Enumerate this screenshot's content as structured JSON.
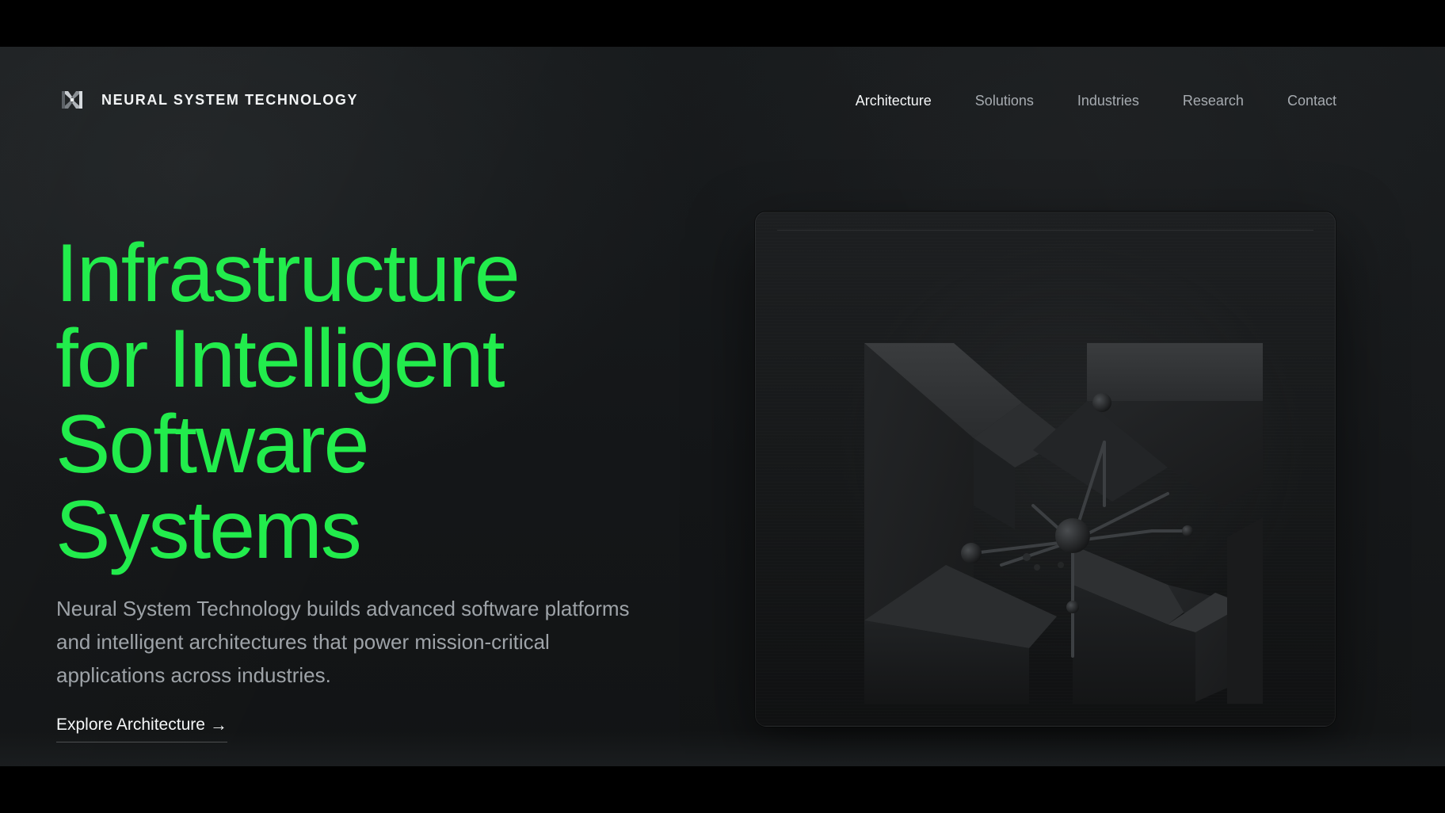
{
  "header": {
    "brand_name": "NEURAL SYSTEM TECHNOLOGY",
    "brand_icon": "nst-logo-icon",
    "nav": [
      {
        "label": "Architecture",
        "active": true
      },
      {
        "label": "Solutions",
        "active": false
      },
      {
        "label": "Industries",
        "active": false
      },
      {
        "label": "Research",
        "active": false
      },
      {
        "label": "Contact",
        "active": false
      }
    ]
  },
  "hero": {
    "title_lines": [
      "Infrastructure",
      "for Intelligent",
      "Software",
      "Systems"
    ],
    "description_lines": [
      "Neural System Technology builds advanced software platforms",
      "and intelligent architectures that power mission-critical",
      "applications across industries."
    ],
    "cta_label": "Explore Architecture",
    "cta_arrow": "→"
  },
  "visual": {
    "icon": "neural-x-emblem-icon"
  },
  "colors": {
    "accent": "#22ec4c",
    "text_primary": "#f4f6f7",
    "text_muted": "#9ea3a8",
    "background": "#16181a"
  }
}
